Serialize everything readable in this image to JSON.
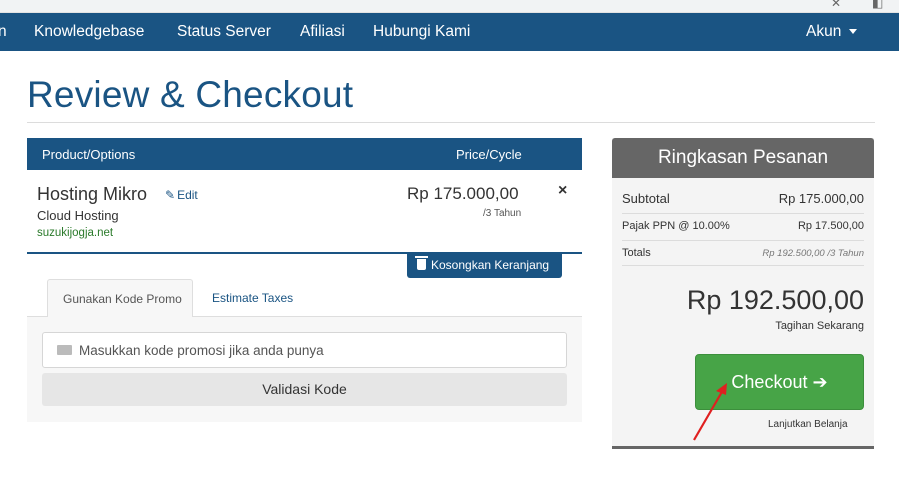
{
  "nav": {
    "items": [
      "n",
      "Knowledgebase",
      "Status Server",
      "Afiliasi",
      "Hubungi Kami"
    ],
    "account": "Akun"
  },
  "page": {
    "title": "Review & Checkout"
  },
  "cart": {
    "col_product": "Product/Options",
    "col_price": "Price/Cycle",
    "item": {
      "name": "Hosting Mikro",
      "edit": "Edit",
      "group": "Cloud Hosting",
      "domain": "suzukijogja.net",
      "price": "Rp 175.000,00",
      "cycle": "/3 Tahun",
      "remove": "×"
    },
    "empty_button": "Kosongkan Keranjang"
  },
  "promo": {
    "tab_active": "Gunakan Kode Promo",
    "tab_inactive": "Estimate Taxes",
    "placeholder": "Masukkan kode promosi jika anda punya",
    "validate": "Validasi Kode"
  },
  "summary": {
    "title": "Ringkasan Pesanan",
    "subtotal_label": "Subtotal",
    "subtotal_value": "Rp 175.000,00",
    "tax_label": "Pajak PPN @ 10.00%",
    "tax_value": "Rp 17.500,00",
    "totals_label": "Totals",
    "totals_value": "Rp 192.500,00 /3 Tahun",
    "total_due": "Rp 192.500,00",
    "total_due_note": "Tagihan Sekarang",
    "checkout": "Checkout",
    "continue": "Lanjutkan Belanja"
  },
  "colors": {
    "brand": "#1a5483",
    "checkout_green": "#47a447",
    "summary_header": "#666666",
    "annotation_arrow": "#e02020"
  },
  "icons": [
    "close-icon",
    "pencil-icon",
    "trash-icon",
    "ticket-icon",
    "arrow-right-icon",
    "caret-down-icon"
  ]
}
